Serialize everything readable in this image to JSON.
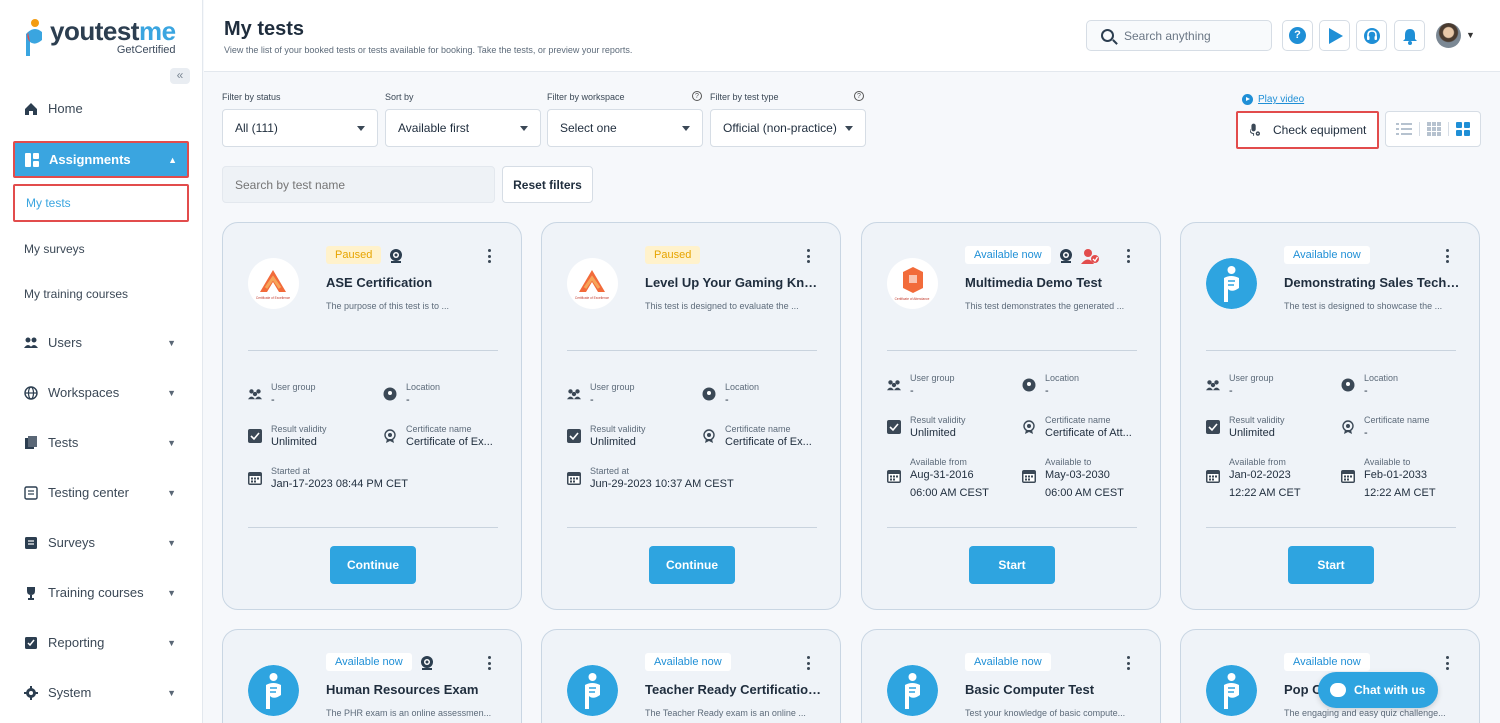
{
  "brand": {
    "name_a": "youtest",
    "name_b": "me",
    "sub": "GetCertified"
  },
  "sidebar": {
    "collapse": "«",
    "home": "Home",
    "assignments": "Assignments",
    "my_tests": "My tests",
    "my_surveys": "My surveys",
    "my_training": "My training courses",
    "users": "Users",
    "workspaces": "Workspaces",
    "tests": "Tests",
    "testing_center": "Testing center",
    "surveys": "Surveys",
    "training_courses": "Training courses",
    "reporting": "Reporting",
    "system": "System"
  },
  "header": {
    "title": "My tests",
    "subtitle": "View the list of your booked tests or tests available for booking. Take the tests, or preview your reports.",
    "search_placeholder": "Search anything",
    "help": "?"
  },
  "filters": {
    "status_label": "Filter by status",
    "status_value": "All (111)",
    "sort_label": "Sort by",
    "sort_value": "Available first",
    "workspace_label": "Filter by workspace",
    "workspace_value": "Select one",
    "type_label": "Filter by test type",
    "type_value": "Official (non-practice)",
    "search_placeholder": "Search by test name",
    "reset": "Reset filters",
    "play_video": "Play video",
    "check_equipment": "Check equipment"
  },
  "fields": {
    "user_group": "User group",
    "location": "Location",
    "result_validity": "Result validity",
    "certificate_name": "Certificate name",
    "started_at": "Started at",
    "available_from": "Available from",
    "available_to": "Available to"
  },
  "cards": [
    {
      "badge": "Paused",
      "title": "ASE Certification",
      "desc": "The purpose of this test is to ...",
      "user_group": "-",
      "location": "-",
      "validity": "Unlimited",
      "certificate": "Certificate of Ex...",
      "started": "Jan-17-2023 08:44 PM CET",
      "button": "Continue"
    },
    {
      "badge": "Paused",
      "title": "Level Up Your Gaming Knowl...",
      "desc": "This test is designed to evaluate the ...",
      "user_group": "-",
      "location": "-",
      "validity": "Unlimited",
      "certificate": "Certificate of Ex...",
      "started": "Jun-29-2023 10:37 AM CEST",
      "button": "Continue"
    },
    {
      "badge": "Available now",
      "title": "Multimedia Demo Test",
      "desc": "This test demonstrates the generated ...",
      "user_group": "-",
      "location": "-",
      "validity": "Unlimited",
      "certificate": "Certificate of Att...",
      "from_date": "Aug-31-2016",
      "from_time": "06:00 AM CEST",
      "to_date": "May-03-2030",
      "to_time": "06:00 AM CEST",
      "button": "Start"
    },
    {
      "badge": "Available now",
      "title": "Demonstrating Sales Techni...",
      "desc": "The test is designed to showcase the ...",
      "user_group": "-",
      "location": "-",
      "validity": "Unlimited",
      "certificate": "-",
      "from_date": "Jan-02-2023",
      "from_time": "12:22 AM CET",
      "to_date": "Feb-01-2033",
      "to_time": "12:22 AM CET",
      "button": "Start"
    },
    {
      "badge": "Available now",
      "title": "Human Resources Exam",
      "desc": "The PHR exam is an online assessmen..."
    },
    {
      "badge": "Available now",
      "title": "Teacher Ready Certification ...",
      "desc": "The Teacher Ready exam is an online ..."
    },
    {
      "badge": "Available now",
      "title": "Basic Computer Test",
      "desc": "Test your knowledge of basic compute..."
    },
    {
      "badge": "Available now",
      "title": "Pop C",
      "desc": "The engaging and easy quiz challenge..."
    }
  ],
  "chat": "Chat with us",
  "colors": {
    "accent": "#2ea4e0",
    "highlight": "#e24c4c",
    "paused": "#e6a400"
  }
}
